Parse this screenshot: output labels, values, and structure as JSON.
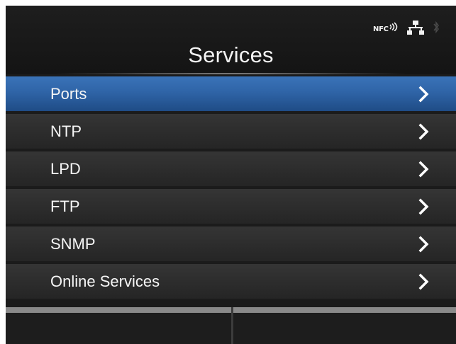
{
  "header": {
    "title": "Services",
    "status_icons": {
      "nfc_text": "NFC",
      "nfc_icon": "nfc-icon",
      "network_icon": "network-icon",
      "bluetooth_icon": "bluetooth-icon"
    }
  },
  "menu": {
    "selected_index": 0,
    "items": [
      {
        "label": "Ports",
        "icon": "chevron-right-icon"
      },
      {
        "label": "NTP",
        "icon": "chevron-right-icon"
      },
      {
        "label": "LPD",
        "icon": "chevron-right-icon"
      },
      {
        "label": "FTP",
        "icon": "chevron-right-icon"
      },
      {
        "label": "SNMP",
        "icon": "chevron-right-icon"
      },
      {
        "label": "Online Services",
        "icon": "chevron-right-icon"
      }
    ]
  },
  "colors": {
    "selected": "#2f64a7",
    "item_bg": "#2d2d2d",
    "text": "#f5f5f5"
  }
}
